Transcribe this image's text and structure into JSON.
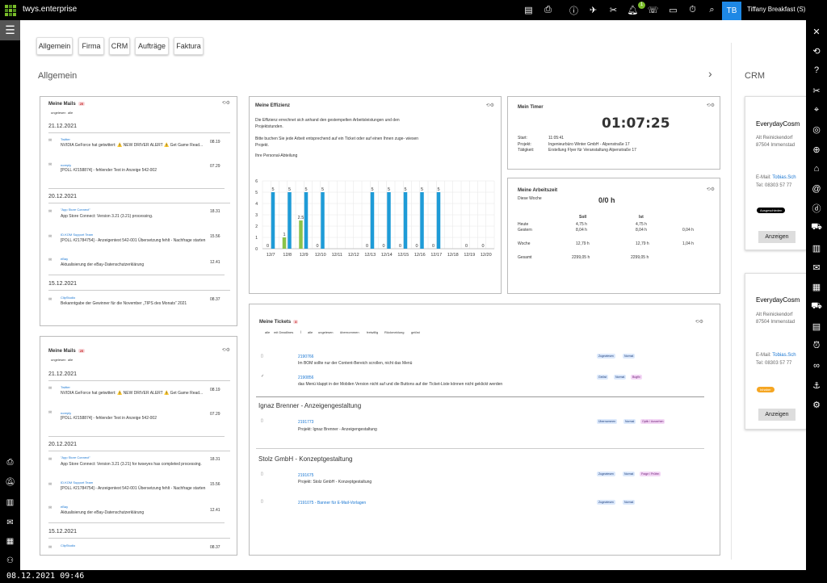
{
  "app": {
    "title": "twys.enterprise",
    "user_initials": "TB",
    "user_name": "Tiffany Breakfast (S)",
    "notification_count": "1"
  },
  "topbar_icons": [
    "id-card-icon",
    "printer-icon",
    "info-icon",
    "rocket-icon",
    "tools-icon",
    "bell-icon",
    "phone-icon",
    "chat-icon",
    "stopwatch-icon",
    "search-icon"
  ],
  "tabs": [
    "Allgemein",
    "Firma",
    "CRM",
    "Aufträge",
    "Faktura"
  ],
  "sections": {
    "main": "Allgemein",
    "crm": "CRM"
  },
  "mails1": {
    "title": "Meine Mails",
    "badge": "25",
    "filters": [
      "ungelesen",
      "alle"
    ],
    "groups": [
      {
        "date": "21.12.2021",
        "items": [
          {
            "sender": "Twitter",
            "text": "NVIDIA GeForce hat getwittert: ⚠️ NEW DRIVER ALERT ⚠️ Get Game Read...",
            "time": "08.19"
          },
          {
            "sender": "noreply",
            "text": "[POLL #2158874] - fehlender Text in Anzeige 542-002",
            "time": "07.29"
          }
        ]
      },
      {
        "date": "20.12.2021",
        "items": [
          {
            "sender": "\"App Store Connect\"",
            "text": "App Store Connect: Version 3.21 (3.21) processing.",
            "time": "18.31"
          },
          {
            "sender": "ID.KOM Support Team",
            "text": "[POLL #21784754] - Anzeigentext 542-001 Übersetzung fehlt - Nachfrage starten",
            "time": "15.56"
          },
          {
            "sender": "eBay",
            "text": "Aktualisierung der eBay-Datenschutzerklärung",
            "time": "12.41"
          }
        ]
      },
      {
        "date": "15.12.2021",
        "items": [
          {
            "sender": "ClipStudio",
            "text": "Bekanntgabe der Gewinner für die November „TIPS des Monats“ 2021",
            "time": "08.37"
          }
        ]
      }
    ]
  },
  "mails2": {
    "title": "Meine Mails",
    "badge": "25",
    "filters": [
      "ungelesen",
      "alle"
    ],
    "groups": [
      {
        "date": "21.12.2021",
        "items": [
          {
            "sender": "Twitter",
            "text": "NVIDIA GeForce hat getwittert: ⚠️ NEW DRIVER ALERT ⚠️ Get Game Read...",
            "time": "08.19"
          },
          {
            "sender": "noreply",
            "text": "[POLL #2158874] - fehlender Text in Anzeige 542-002",
            "time": "07.29"
          }
        ]
      },
      {
        "date": "20.12.2021",
        "items": [
          {
            "sender": "\"App Store Connect\"",
            "text": "App Store Connect: Version 3.21 (3.21) for twseyes has completed processing.",
            "time": "18.31"
          },
          {
            "sender": "ID.KOM Support Team",
            "text": "[POLL #21784754] - Anzeigentext 542-001 Übersetzung fehlt - Nachfrage starten",
            "time": "15.56"
          },
          {
            "sender": "eBay",
            "text": "Aktualisierung der eBay-Datenschutzerklärung",
            "time": "12.41"
          }
        ]
      },
      {
        "date": "15.12.2021",
        "items": [
          {
            "sender": "ClipStudio",
            "text": "",
            "time": "08.37"
          }
        ]
      }
    ]
  },
  "effizienz": {
    "title": "Meine Effizienz",
    "text1": "Die Effizienz errechnet sich anhand den gestempelten Arbeitsleistungen und den Projektstunden.",
    "text2": "Bitte buchen Sie jede Arbeit entsprechend auf ein Ticket oder auf einen Ihnen zuge- wiesen Projekt.",
    "text3": "Ihre Personal-Abteilung"
  },
  "chart_data": {
    "type": "bar",
    "categories": [
      "12/7",
      "12/8",
      "12/9",
      "12/10",
      "12/11",
      "12/12",
      "12/13",
      "12/14",
      "12/15",
      "12/16",
      "12/17",
      "12/18",
      "12/19",
      "12/20"
    ],
    "series": [
      {
        "values": [
          5,
          5,
          5,
          5,
          null,
          null,
          5,
          5,
          5,
          5,
          5,
          null,
          null,
          null
        ],
        "color": "#1e9bd7"
      },
      {
        "values": [
          0,
          1,
          2.5,
          0,
          null,
          null,
          0,
          0,
          0,
          0,
          0,
          null,
          0,
          0
        ],
        "color": "#8bc34a"
      }
    ],
    "ylim": [
      0,
      6
    ],
    "yticks": [
      0,
      1,
      2,
      3,
      4,
      5,
      6
    ],
    "grid": true
  },
  "timer": {
    "title": "Mein Timer",
    "value": "01:07:25",
    "rows": [
      {
        "label": "Start:",
        "value": "11:05:41"
      },
      {
        "label": "Projekt:",
        "value": "Ingenieurbüro Winter GmbH - Alpenstraße 17"
      },
      {
        "label": "Tätigkeit:",
        "value": "Erstellung Flyer für Veranstaltung Alpenstraße 17"
      }
    ]
  },
  "arbeitszeit": {
    "title": "Meine Arbeitszeit",
    "week_label": "Diese Woche",
    "week_value": "0/0 h",
    "col_soll": "Soll",
    "col_ist": "Ist",
    "rows": [
      {
        "label": "Heute",
        "soll": "4,75 h",
        "ist": "4,75 h",
        "diff": ""
      },
      {
        "label": "Gestern",
        "soll": "8,04 h",
        "ist": "8,04 h",
        "diff": "0,04 h"
      },
      {
        "label": "Woche",
        "soll": "12,79 h",
        "ist": "12,79 h",
        "diff": "1,04 h"
      },
      {
        "label": "Gesamt",
        "soll": "2299,05 h",
        "ist": "2299,05 h",
        "diff": ""
      }
    ]
  },
  "tickets": {
    "title": "Meine Tickets",
    "badge": "8",
    "filters": [
      "alle",
      "mit Deadlines",
      "|",
      "alle",
      "ungelesen",
      "übernommen",
      "freiwillig",
      "Rückmeldung",
      "gelöst"
    ],
    "items": [
      {
        "id": "2190766",
        "desc": "Im BOM sollte nur der Content-Bereich scrollen, nicht das Menü",
        "tags": [
          "Zugewiesen",
          "Normal"
        ]
      },
      {
        "id": "2190856",
        "desc": "das Menü klappt in der Mobilen Version nicht auf und die Buttons auf der Ticket-Liste können nicht geklickt werden",
        "tags": [
          "Gelöst",
          "Normal",
          "Bugfix"
        ]
      }
    ],
    "groups": [
      {
        "name": "Ignaz Brenner - Anzeigengestaltung",
        "items": [
          {
            "id": "2191773",
            "desc": "Projekt: Ignaz Brenner - Anzeigengestaltung",
            "tags": [
              "Übernommen",
              "Normal",
              "Optik / Aussehen"
            ]
          }
        ]
      },
      {
        "name": "Stolz GmbH - Konzeptgestaltung",
        "items": [
          {
            "id": "2191675",
            "desc": "Projekt: Stolz GmbH - Konzeptgestaltung",
            "tags": [
              "Zugewiesen",
              "Normal",
              "Frage / Prüfen"
            ]
          },
          {
            "id": "2191075 - Banner für E-Mail-Vorlagen",
            "desc": "",
            "tags": [
              "Zugewiesen",
              "Normal"
            ]
          }
        ]
      }
    ]
  },
  "crm": [
    {
      "name": "EverydayCosm",
      "street": "Alt Reinickendorf",
      "city": "87504 Immenstad",
      "email_label": "E-Mail:",
      "email": "Tobias.Sch",
      "tel": "Tel: 08303 57 77",
      "badge": "Ausgeschieden",
      "button": "Anzeigen"
    },
    {
      "name": "EverydayCosm",
      "street": "Alt Reinickendorf",
      "city": "87504 Immenstad",
      "email_label": "E-Mail:",
      "email": "Tobias.Sch",
      "tel": "Tel: 08303 57 77",
      "badge": "Inhaber",
      "button": "Anzeigen"
    }
  ],
  "status_time": "08.12.2021 09:46",
  "colors": {
    "accent": "#1e88e5",
    "bar_blue": "#1e9bd7",
    "bar_green": "#8bc34a",
    "logo_green": "#7bbd2a"
  }
}
